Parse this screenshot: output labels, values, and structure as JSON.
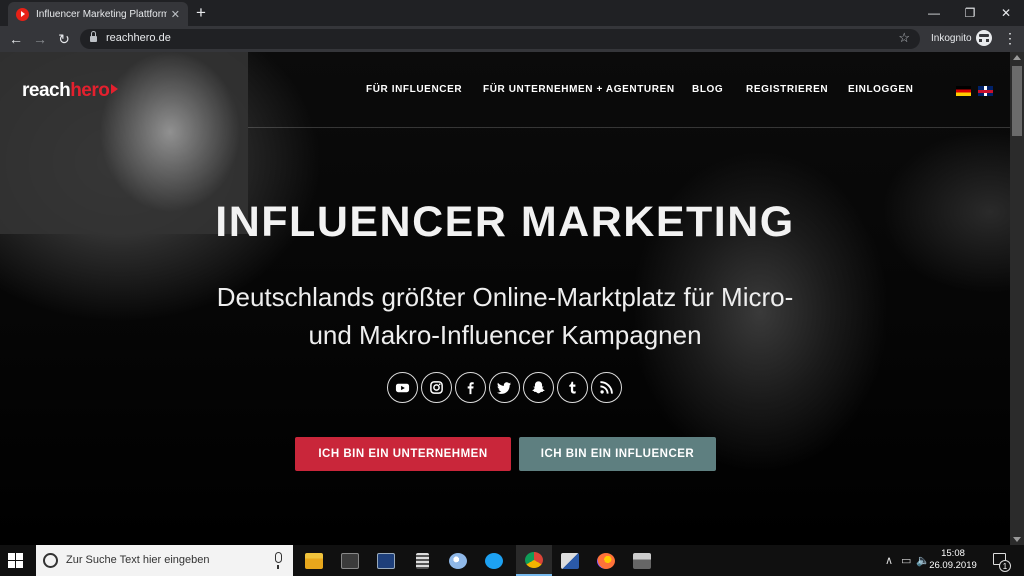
{
  "browser": {
    "tab_title": "Influencer Marketing Plattform: T",
    "tab_close": "✕",
    "new_tab": "+",
    "url": "reachhero.de",
    "incognito_label": "Inkognito",
    "window_controls": {
      "minimize": "—",
      "restore": "❐",
      "close": "✕"
    },
    "nav_buttons": {
      "back": "←",
      "forward": "→",
      "reload": "↻",
      "star": "☆",
      "menu": "⋮"
    }
  },
  "site": {
    "logo": {
      "part1": "reach",
      "part2": "hero"
    },
    "nav": [
      {
        "label": "FÜR INFLUENCER"
      },
      {
        "label": "FÜR UNTERNEHMEN + AGENTUREN"
      },
      {
        "label": "BLOG"
      },
      {
        "label": "REGISTRIEREN"
      },
      {
        "label": "EINLOGGEN"
      }
    ],
    "headline": "INFLUENCER MARKETING",
    "subline_1": "Deutschlands größter Online-Marktplatz für Micro-",
    "subline_2": "und Makro-Influencer Kampagnen",
    "socials": [
      "youtube-icon",
      "instagram-icon",
      "facebook-icon",
      "twitter-icon",
      "snapchat-icon",
      "tumblr-icon",
      "rss-icon"
    ],
    "cta_company": "ICH BIN EIN UNTERNEHMEN",
    "cta_influencer": "ICH BIN EIN INFLUENCER",
    "colors": {
      "brand_red": "#e3202e",
      "cta_red": "#c9263a",
      "cta_teal": "#5e7f80"
    }
  },
  "taskbar": {
    "search_placeholder": "Zur Suche Text hier eingeben",
    "time": "15:08",
    "date": "26.09.2019",
    "notification_count": "1",
    "tray_chevron": "∧",
    "tray_network": "▭",
    "tray_volume": "🔈"
  }
}
